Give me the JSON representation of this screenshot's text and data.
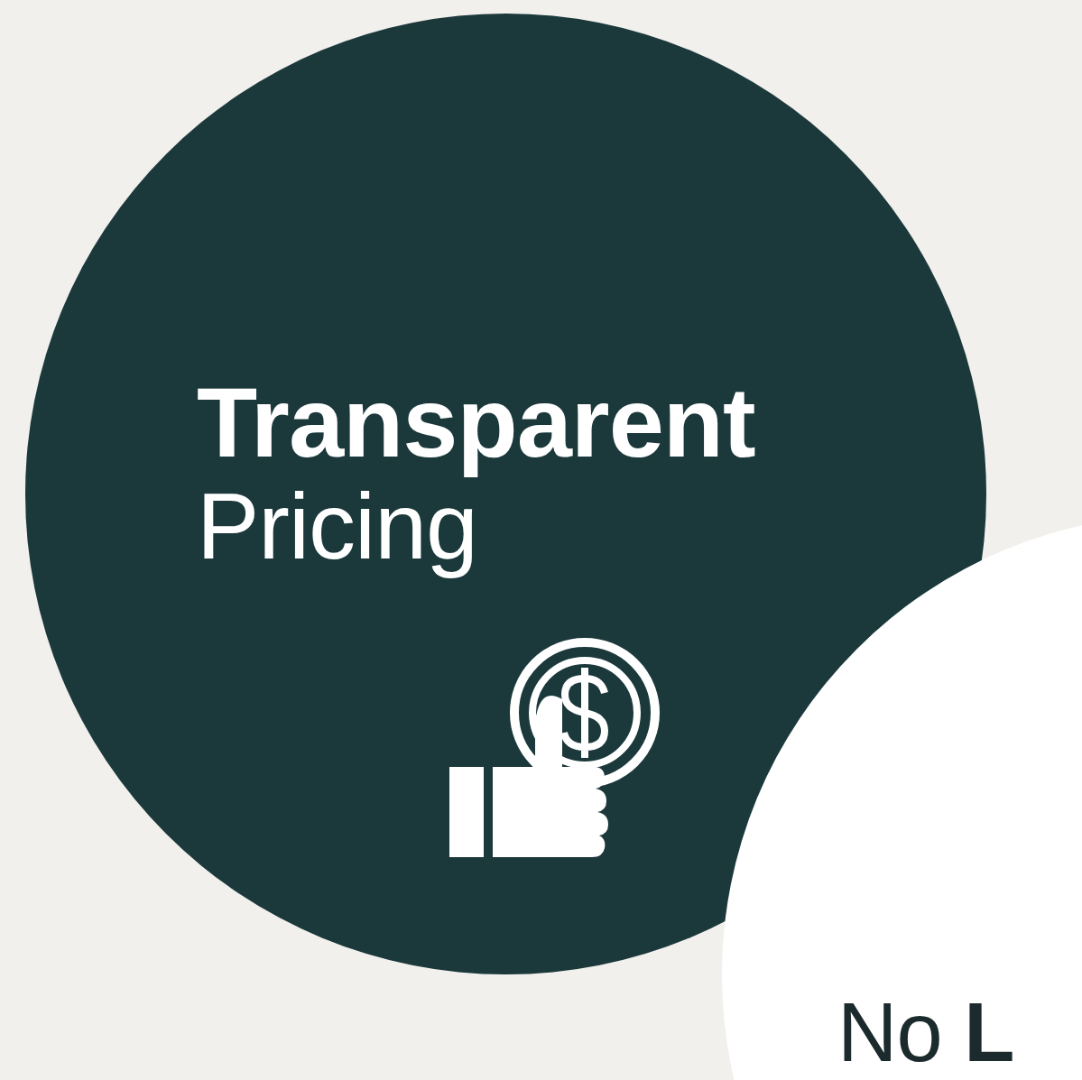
{
  "feature_circle": {
    "title": "Transparent",
    "subtitle": "Pricing"
  },
  "next_circle": {
    "title": "No **L**"
  }
}
